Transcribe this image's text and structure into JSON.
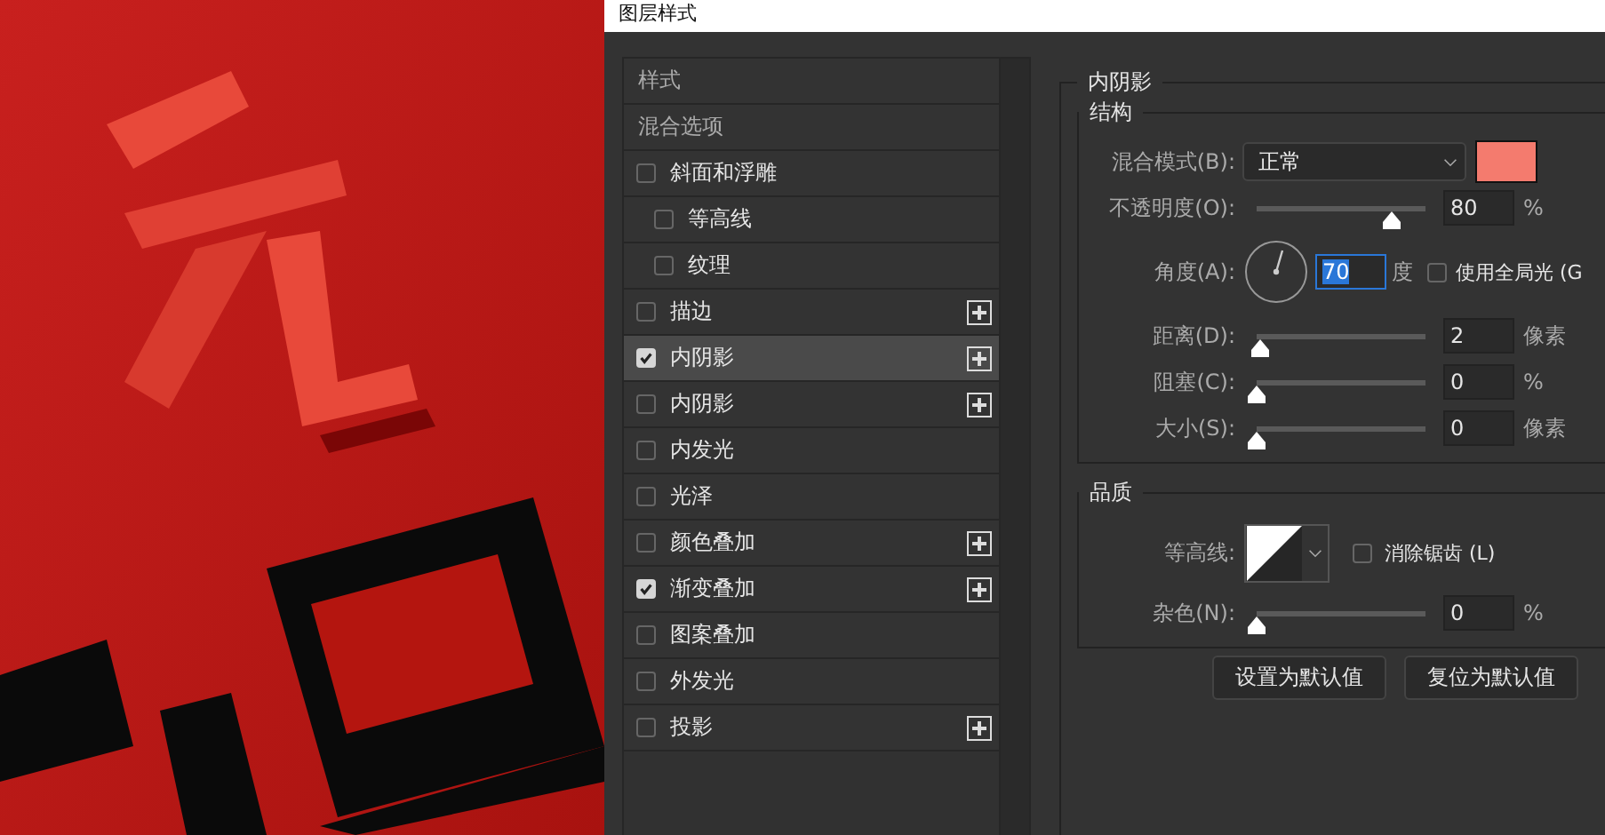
{
  "window": {
    "title": "图层样式"
  },
  "canvas": {
    "kind": "picture"
  },
  "styles_list": [
    {
      "kind": "header",
      "label": "样式",
      "selected": false
    },
    {
      "kind": "header",
      "label": "混合选项",
      "selected": false
    },
    {
      "kind": "effect",
      "label": "斜面和浮雕",
      "checked": false,
      "selected": false,
      "plus": false,
      "children": [
        {
          "kind": "effect",
          "label": "等高线",
          "checked": false,
          "selected": false,
          "plus": false
        },
        {
          "kind": "effect",
          "label": "纹理",
          "checked": false,
          "selected": false,
          "plus": false
        }
      ]
    },
    {
      "kind": "effect",
      "label": "描边",
      "checked": false,
      "selected": false,
      "plus": true
    },
    {
      "kind": "effect",
      "label": "内阴影",
      "checked": true,
      "selected": true,
      "plus": true
    },
    {
      "kind": "effect",
      "label": "内阴影",
      "checked": false,
      "selected": false,
      "plus": true
    },
    {
      "kind": "effect",
      "label": "内发光",
      "checked": false,
      "selected": false,
      "plus": false
    },
    {
      "kind": "effect",
      "label": "光泽",
      "checked": false,
      "selected": false,
      "plus": false
    },
    {
      "kind": "effect",
      "label": "颜色叠加",
      "checked": false,
      "selected": false,
      "plus": true
    },
    {
      "kind": "effect",
      "label": "渐变叠加",
      "checked": true,
      "selected": false,
      "plus": true
    },
    {
      "kind": "effect",
      "label": "图案叠加",
      "checked": false,
      "selected": false,
      "plus": false
    },
    {
      "kind": "effect",
      "label": "外发光",
      "checked": false,
      "selected": false,
      "plus": false
    },
    {
      "kind": "effect",
      "label": "投影",
      "checked": false,
      "selected": false,
      "plus": true
    }
  ],
  "panel": {
    "title": "内阴影",
    "structure": {
      "title": "结构",
      "blend_mode": {
        "label": "混合模式(B):",
        "value": "正常",
        "color": "#f47b6e"
      },
      "opacity": {
        "label": "不透明度(O):",
        "level": 0.8,
        "value": "80",
        "unit": "%"
      },
      "angle": {
        "label": "角度(A):",
        "value": "70",
        "unit": "度",
        "global_light": {
          "label": "使用全局光 (G",
          "checked": false
        }
      },
      "sliders": [
        {
          "label": "距离(D):",
          "level": 0.02,
          "value": "2",
          "unit": "像素"
        },
        {
          "label": "阻塞(C):",
          "level": 0,
          "value": "0",
          "unit": "%"
        },
        {
          "label": "大小(S):",
          "level": 0,
          "value": "0",
          "unit": "像素"
        }
      ]
    },
    "quality": {
      "title": "品质",
      "contour": {
        "label": "等高线:",
        "anti_alias": {
          "label": "消除锯齿 (L)",
          "checked": false
        }
      },
      "noise": {
        "label": "杂色(N):",
        "level": 0,
        "value": "0",
        "unit": "%"
      }
    }
  },
  "buttons": [
    "设置为默认值",
    "复位为默认值"
  ]
}
